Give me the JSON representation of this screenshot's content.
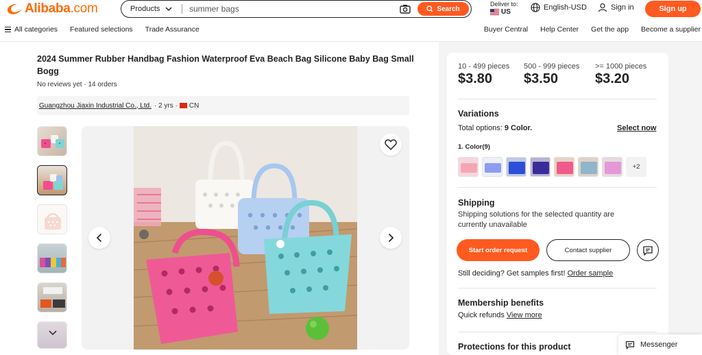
{
  "header": {
    "logo_text": "Alibaba",
    "logo_suffix": ".com",
    "search_category": "Products",
    "search_placeholder": "summer bags",
    "search_button": "Search",
    "deliver_label": "Deliver to:",
    "deliver_country": "US",
    "language": "English-USD",
    "sign_in": "Sign in",
    "sign_up": "Sign up"
  },
  "nav": {
    "left": [
      "All categories",
      "Featured selections",
      "Trade Assurance"
    ],
    "right": [
      "Buyer Central",
      "Help Center",
      "Get the app",
      "Become a supplier"
    ]
  },
  "product": {
    "title": "2024 Summer Rubber Handbag Fashion Waterproof Eva Beach Bag Silicone Baby Bag Small Bogg",
    "reviews": "No reviews yet · 14 orders",
    "supplier": "Guangzhou Jiaxin Industrial Co., Ltd.",
    "supplier_meta": "· 2 yrs ·",
    "supplier_country": "CN"
  },
  "pricing": {
    "tiers": [
      {
        "range": "10 - 499 pieces",
        "price": "$3.80"
      },
      {
        "range": "500 - 999 pieces",
        "price": "$3.50"
      },
      {
        "range": ">= 1000 pieces",
        "price": "$3.20"
      }
    ]
  },
  "variations": {
    "title": "Variations",
    "total_prefix": "Total options: ",
    "total_value": "9 Color.",
    "select_now": "Select now",
    "color_label": "1. Color(9)",
    "more": "+2",
    "swatch_colors": [
      "#f3a7b6",
      "#8f9df0",
      "#2d4fd8",
      "#3a2d9a",
      "#f05a8c",
      "#8fb6c9",
      "#e598d8"
    ]
  },
  "shipping": {
    "title": "Shipping",
    "text": "Shipping solutions for the selected quantity are currently unavailable"
  },
  "actions": {
    "start_order": "Start order request",
    "contact": "Contact supplier"
  },
  "samples": {
    "text": "Still deciding? Get samples first! ",
    "link": "Order sample"
  },
  "membership": {
    "title": "Membership benefits",
    "text": "Quick refunds ",
    "link": "View more"
  },
  "protections": {
    "title": "Protections for this product"
  },
  "messenger": {
    "label": "Messenger"
  },
  "colors": {
    "accent": "#ff5a1f",
    "brand": "#ff6a00"
  }
}
